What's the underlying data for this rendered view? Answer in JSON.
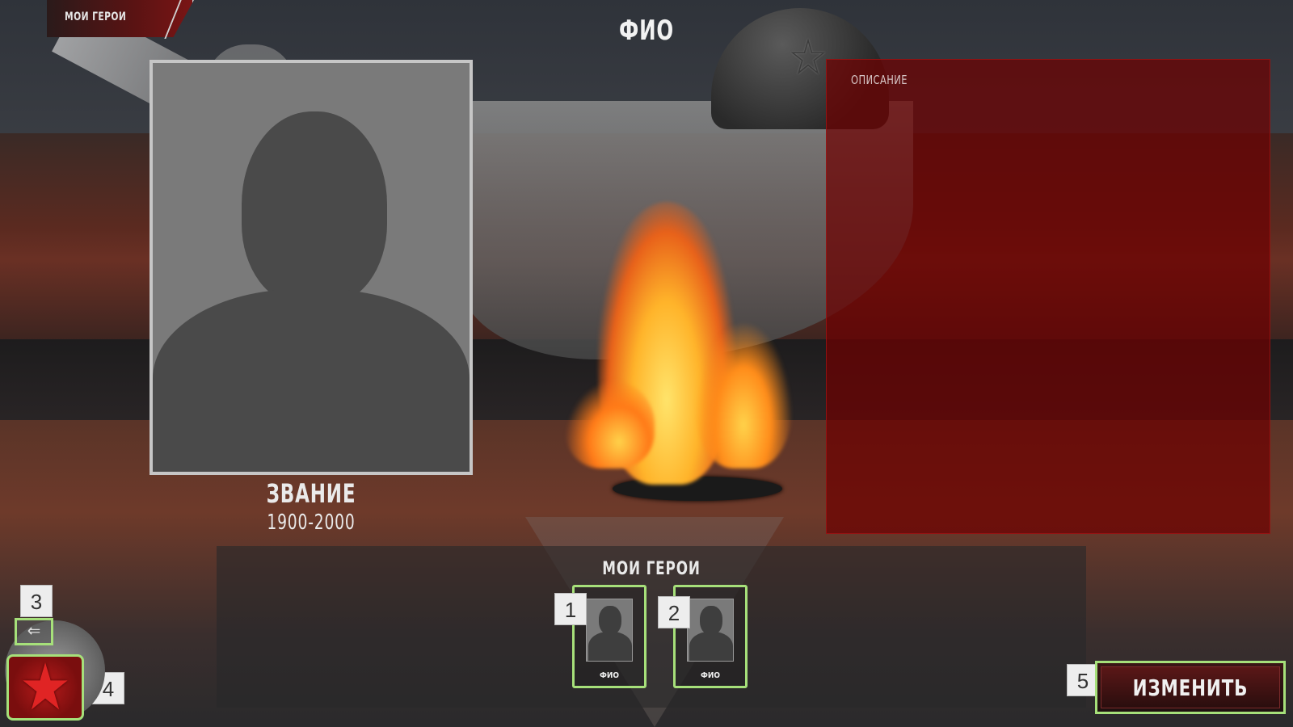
{
  "header": {
    "tab_label": "МОИ ГЕРОИ",
    "title": "ФИО"
  },
  "profile": {
    "rank": "ЗВАНИЕ",
    "years": "1900-2000"
  },
  "description": {
    "label": "ОПИСАНИЕ"
  },
  "heroes": {
    "title": "МОИ ГЕРОИ",
    "items": [
      {
        "name": "ФИО"
      },
      {
        "name": "ФИО"
      }
    ]
  },
  "markers": [
    "1",
    "2",
    "3",
    "4",
    "5"
  ],
  "actions": {
    "change_label": "ИЗМЕНИТЬ",
    "back_icon": "back-arrow-icon",
    "menu_icon": "red-star-icon"
  },
  "colors": {
    "highlight": "#a6e07a",
    "panel_red": "#6e0000",
    "accent_red": "#e02424"
  }
}
